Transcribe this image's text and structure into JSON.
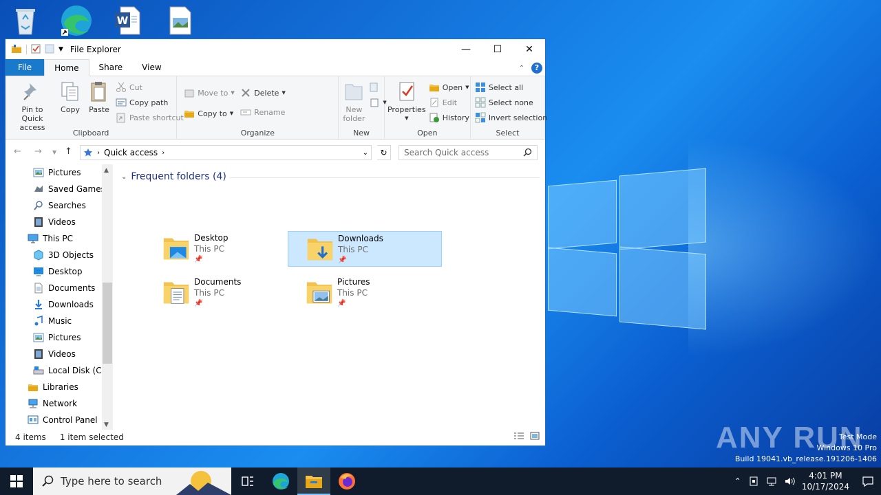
{
  "window": {
    "title": "File Explorer",
    "minimize_label": "—",
    "maximize_label": "☐",
    "close_label": "✕"
  },
  "ribbon": {
    "tabs": [
      "File",
      "Home",
      "Share",
      "View"
    ],
    "help_label": "?",
    "clipboard": {
      "pin_label_1": "Pin to Quick",
      "pin_label_2": "access",
      "copy": "Copy",
      "paste": "Paste",
      "cut": "Cut",
      "copy_path": "Copy path",
      "paste_shortcut": "Paste shortcut",
      "group": "Clipboard"
    },
    "organize": {
      "move_to": "Move to",
      "copy_to": "Copy to",
      "delete": "Delete",
      "rename": "Rename",
      "group": "Organize"
    },
    "new": {
      "new_folder_1": "New",
      "new_folder_2": "folder",
      "group": "New"
    },
    "open": {
      "properties": "Properties",
      "open": "Open",
      "edit": "Edit",
      "history": "History",
      "group": "Open"
    },
    "select": {
      "select_all": "Select all",
      "select_none": "Select none",
      "invert": "Invert selection",
      "group": "Select"
    }
  },
  "address": {
    "path": "Quick access",
    "search_placeholder": "Search Quick access"
  },
  "nav": {
    "items": [
      {
        "label": "Pictures",
        "icon": "pictures-icon",
        "indent": 2
      },
      {
        "label": "Saved Games",
        "icon": "saved-games-icon",
        "indent": 2
      },
      {
        "label": "Searches",
        "icon": "searches-icon",
        "indent": 2
      },
      {
        "label": "Videos",
        "icon": "videos-icon",
        "indent": 2
      },
      {
        "label": "This PC",
        "icon": "this-pc-icon",
        "indent": 1
      },
      {
        "label": "3D Objects",
        "icon": "3d-objects-icon",
        "indent": 2
      },
      {
        "label": "Desktop",
        "icon": "desktop-icon",
        "indent": 2
      },
      {
        "label": "Documents",
        "icon": "documents-icon",
        "indent": 2
      },
      {
        "label": "Downloads",
        "icon": "downloads-icon",
        "indent": 2
      },
      {
        "label": "Music",
        "icon": "music-icon",
        "indent": 2
      },
      {
        "label": "Pictures",
        "icon": "pictures-icon",
        "indent": 2
      },
      {
        "label": "Videos",
        "icon": "videos-icon",
        "indent": 2
      },
      {
        "label": "Local Disk (C:)",
        "icon": "local-disk-icon",
        "indent": 2
      },
      {
        "label": "Libraries",
        "icon": "libraries-icon",
        "indent": 1
      },
      {
        "label": "Network",
        "icon": "network-icon",
        "indent": 1
      },
      {
        "label": "Control Panel",
        "icon": "control-panel-icon",
        "indent": 1
      }
    ]
  },
  "content": {
    "section_title": "Frequent folders (4)",
    "folders": [
      {
        "name": "Desktop",
        "location": "This PC",
        "selected": false
      },
      {
        "name": "Downloads",
        "location": "This PC",
        "selected": true
      },
      {
        "name": "Documents",
        "location": "This PC",
        "selected": false
      },
      {
        "name": "Pictures",
        "location": "This PC",
        "selected": false
      }
    ]
  },
  "status": {
    "items": "4 items",
    "selected": "1 item selected"
  },
  "taskbar": {
    "search_placeholder": "Type here to search",
    "time": "4:01 PM",
    "date": "10/17/2024"
  },
  "watermark": {
    "line1": "Test Mode",
    "line2": "Windows 10 Pro",
    "line3": "Build 19041.vb_release.191206-1406",
    "brand": "ANY RUN"
  },
  "colors": {
    "accent": "#1979ca",
    "selection": "#cce8ff",
    "taskbar": "#101c2c"
  }
}
